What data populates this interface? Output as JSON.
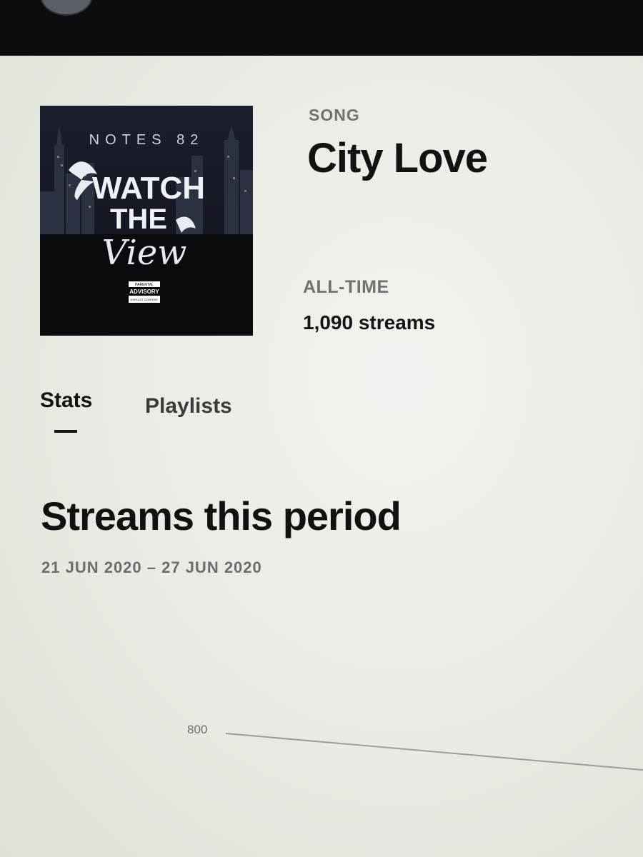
{
  "song": {
    "type_label": "SONG",
    "title": "City Love"
  },
  "stats": {
    "period_label": "ALL-TIME",
    "streams_text": "1,090 streams"
  },
  "cover": {
    "artist": "NOTES 82",
    "title_line1": "WATCH",
    "title_line2": "THE",
    "title_script": "View",
    "advisory_top": "PARENTAL",
    "advisory_main": "ADVISORY",
    "advisory_bottom": "EXPLICIT CONTENT"
  },
  "tabs": [
    {
      "label": "Stats",
      "active": true
    },
    {
      "label": "Playlists",
      "active": false
    }
  ],
  "section": {
    "title": "Streams this period",
    "date_range": "21 JUN 2020 – 27 JUN 2020"
  },
  "chart": {
    "y_tick": "800"
  },
  "colors": {
    "topbar": "#0d0d10",
    "text_primary": "#121212",
    "text_muted": "#6f726f"
  }
}
